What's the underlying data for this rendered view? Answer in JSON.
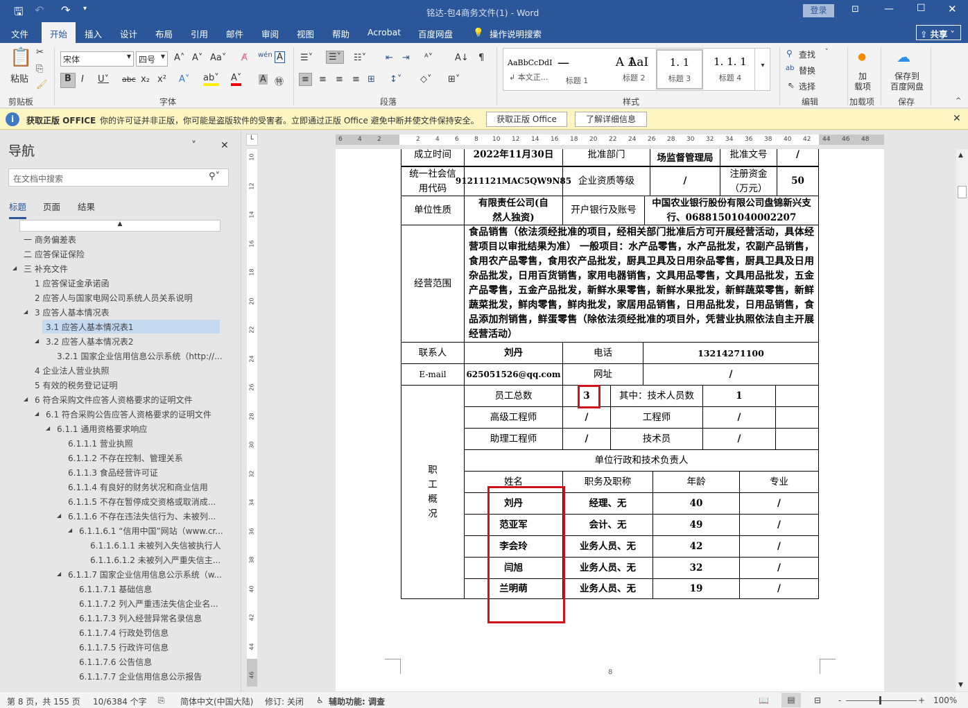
{
  "titlebar": {
    "title": "铭达-包4商务文件(1)  -  Word",
    "login": "登录"
  },
  "tabs": [
    "文件",
    "开始",
    "插入",
    "设计",
    "布局",
    "引用",
    "邮件",
    "审阅",
    "视图",
    "帮助",
    "Acrobat",
    "百度网盘"
  ],
  "tell_me": "操作说明搜索",
  "share": "共享",
  "ribbon": {
    "paste": "粘贴",
    "clipboard": "剪贴板",
    "font_name": "宋体",
    "font_size": "四号",
    "font": "字体",
    "paragraph": "段落",
    "styles_label": "样式",
    "styles": [
      {
        "preview": "AaBbCcDdI",
        "name": "↲ 本文正..."
      },
      {
        "preview": "一",
        "name": "标题 1"
      },
      {
        "preview": "A 1",
        "name": "标题 2"
      },
      {
        "preview": "AaI",
        "name": ""
      },
      {
        "preview": "1. 1",
        "name": "标题 3"
      },
      {
        "preview": "1. 1. 1",
        "name": "标题 4"
      }
    ],
    "find": "查找",
    "replace": "替换",
    "select": "选择",
    "editing": "编辑",
    "addins": "加\n载项",
    "addins_group": "加载项",
    "save_baidu": "保存到\n百度网盘",
    "save_group": "保存"
  },
  "infobar": {
    "title": "获取正版 OFFICE",
    "message": "你的许可证并非正版，你可能是盗版软件的受害者。立即通过正版 Office 避免中断并使文件保持安全。",
    "btn1": "获取正版 Office",
    "btn2": "了解详细信息"
  },
  "nav": {
    "title": "导航",
    "search_placeholder": "在文档中搜索",
    "tabs": [
      "标题",
      "页面",
      "结果"
    ],
    "items": [
      "一 商务偏差表",
      "二 应答保证保险",
      "三 补充文件",
      "1 应答保证金承诺函",
      "2 应答人与国家电网公司系统人员关系说明",
      "3 应答人基本情况表",
      "3.1 应答人基本情况表1",
      "3.2 应答人基本情况表2",
      "3.2.1 国家企业信用信息公示系统（http://...",
      "4 企业法人营业执照",
      "5 有效的税务登记证明",
      "6 符合采购文件应答人资格要求的证明文件",
      "6.1 符合采购公告应答人资格要求的证明文件",
      "6.1.1 通用资格要求响应",
      "6.1.1.1 营业执照",
      "6.1.1.2 不存在控制、管理关系",
      "6.1.1.3 食品经营许可证",
      "6.1.1.4 有良好的财务状况和商业信用",
      "6.1.1.5 不存在暂停成交资格或取消成...",
      "6.1.1.6 不存在违法失信行为、未被列...",
      "6.1.1.6.1 “信用中国”网站（www.cr...",
      "6.1.1.6.1.1 未被列入失信被执行人",
      "6.1.1.6.1.2 未被列入严重失信主...",
      "6.1.1.7 国家企业信用信息公示系统（w...",
      "6.1.1.7.1 基础信息",
      "6.1.1.7.2 列入严重违法失信企业名...",
      "6.1.1.7.3 列入经营异常名录信息",
      "6.1.1.7.4 行政处罚信息",
      "6.1.1.7.5 行政许可信息",
      "6.1.1.7.6 公告信息",
      "6.1.1.7.7 企业信用信息公示报告"
    ]
  },
  "ruler": {
    "top": [
      "6",
      "4",
      "2",
      "2",
      "4",
      "6",
      "8",
      "10",
      "12",
      "14",
      "16",
      "18",
      "20",
      "22",
      "24",
      "26",
      "28",
      "30",
      "32",
      "34",
      "36",
      "38",
      "40",
      "42",
      "44",
      "46",
      "48"
    ],
    "left": [
      "10",
      "12",
      "14",
      "16",
      "18",
      "20",
      "22",
      "24",
      "26",
      "28",
      "30",
      "32",
      "34",
      "36",
      "38",
      "40",
      "42",
      "44",
      "46"
    ]
  },
  "table": {
    "r0": [
      "成立时间",
      "2022年11月30日",
      "批准部门",
      "场监督管理局",
      "批准文号",
      "/"
    ],
    "r1": [
      "统一社会信用代码",
      "91211121MAC5QW9N85",
      "企业资质等级",
      "/",
      "注册资金（万元）",
      "50"
    ],
    "r2": [
      "单位性质",
      "有限责任公司(自然人独资)",
      "开户银行及账号",
      "中国农业银行股份有限公司盘锦新兴支行、06881501040002207"
    ],
    "scope_label": "经营范围",
    "scope": "食品销售（依法须经批准的项目，经相关部门批准后方可开展经营活动，具体经营项目以审批结果为准） 一般项目：水产品零售，水产品批发，农副产品销售，食用农产品零售，食用农产品批发，厨具卫具及日用杂品零售，厨具卫具及日用杂品批发，日用百货销售，家用电器销售，文具用品零售，文具用品批发，五金产品零售，五金产品批发，新鲜水果零售，新鲜水果批发，新鲜蔬菜零售，新鲜蔬菜批发，鲜肉零售，鲜肉批发，家居用品销售，日用品批发，日用品销售，食品添加剂销售，鲜蛋零售（除依法须经批准的项目外，凭营业执照依法自主开展经营活动）",
    "contact": [
      "联系人",
      "刘丹",
      "电话",
      "13214271100"
    ],
    "email": [
      "E-mail",
      "625051526@qq.com",
      "网址",
      "/"
    ],
    "staff_label": "职工概况",
    "s0": [
      "员工总数",
      "3",
      "其中：技术人员数",
      "1",
      ""
    ],
    "s1": [
      "高级工程师",
      "/",
      "工程师",
      "/",
      ""
    ],
    "s2": [
      "助理工程师",
      "/",
      "技术员",
      "/",
      ""
    ],
    "resp": "单位行政和技术负责人",
    "head": [
      "姓名",
      "职务及职称",
      "年龄",
      "专业"
    ],
    "people": [
      [
        "刘丹",
        "经理、无",
        "40",
        "/"
      ],
      [
        "范亚军",
        "会计、无",
        "49",
        "/"
      ],
      [
        "李会玲",
        "业务人员、无",
        "42",
        "/"
      ],
      [
        "闫旭",
        "业务人员、无",
        "32",
        "/"
      ],
      [
        "兰明萌",
        "业务人员、无",
        "19",
        "/"
      ]
    ]
  },
  "page_number": "8",
  "status": {
    "page": "第 8 页，共 155 页",
    "words": "10/6384 个字",
    "lang": "简体中文(中国大陆)",
    "track": "修订: 关闭",
    "access": "辅助功能: 调查",
    "zoom": "100%"
  }
}
